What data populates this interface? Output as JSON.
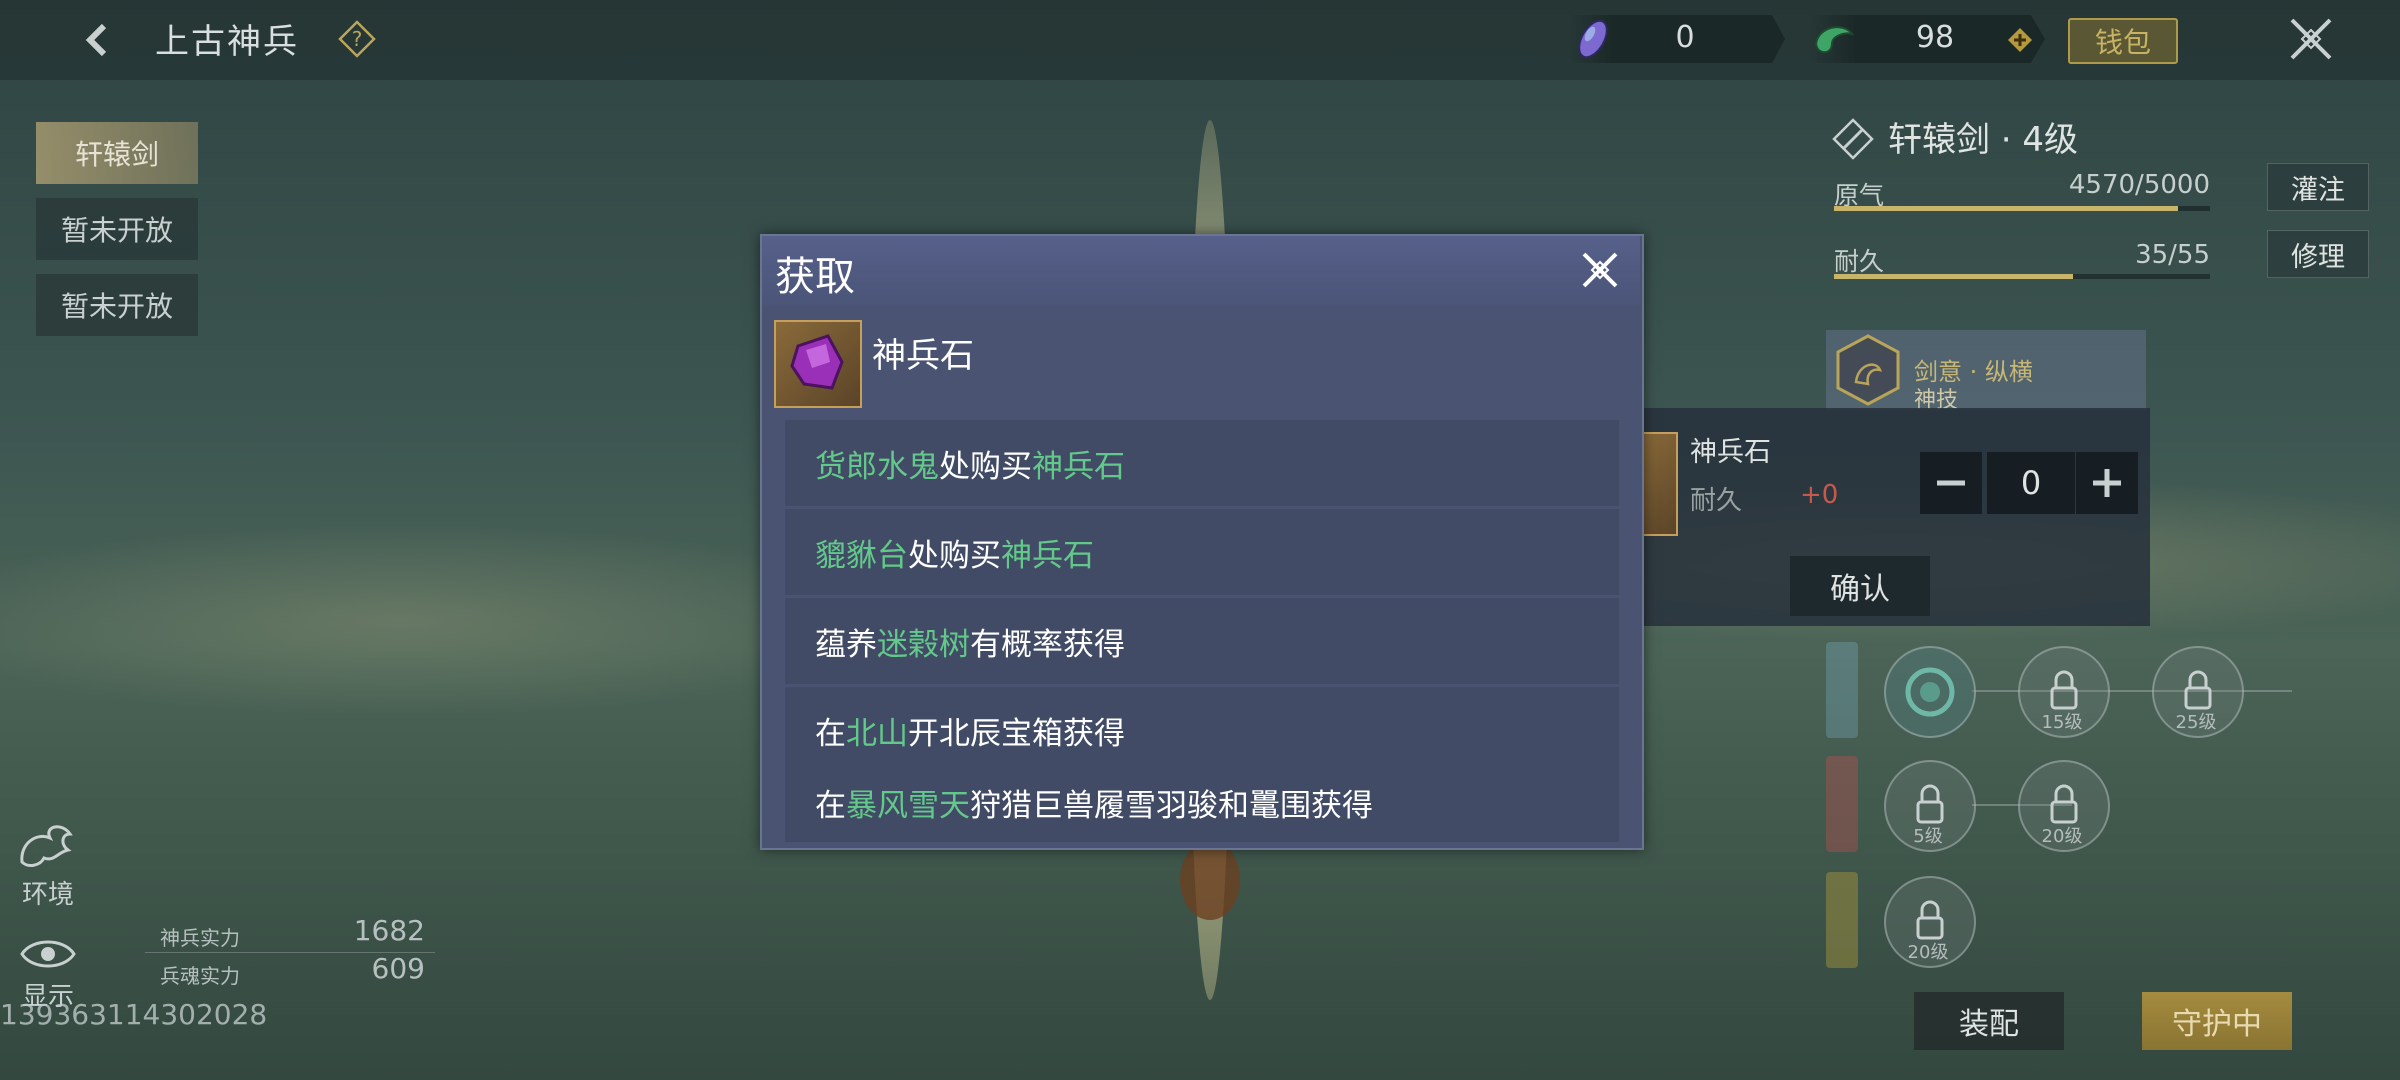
{
  "header": {
    "title": "上古神兵",
    "resource1_value": "0",
    "resource2_value": "98",
    "wallet_label": "钱包"
  },
  "tabs": [
    "轩辕剑",
    "暂未开放",
    "暂未开放"
  ],
  "weapon": {
    "name": "轩辕剑 · 4级",
    "stats": [
      {
        "label": "原气",
        "value": "4570/5000",
        "fill": 0.914,
        "button": "灌注"
      },
      {
        "label": "耐久",
        "value": "35/55",
        "fill": 0.636,
        "button": "修理"
      }
    ],
    "skill": {
      "name": "剑意 · 纵横",
      "sub": "神技"
    }
  },
  "buy_panel": {
    "item_name": "神兵石",
    "durability_label": "耐久",
    "durability_bonus": "+0",
    "quantity": "0",
    "confirm": "确认"
  },
  "slots": {
    "row1": [
      "15级",
      "25级"
    ],
    "row2": [
      "5级",
      "20级"
    ],
    "row3": [
      "20级"
    ]
  },
  "actions": {
    "equip": "装配",
    "guard": "守护中"
  },
  "bottom_left": {
    "env": "环境",
    "show": "显示",
    "power": [
      {
        "label": "神兵实力",
        "value": "1682"
      },
      {
        "label": "兵魂实力",
        "value": "609"
      }
    ],
    "uid": "139363114302028"
  },
  "modal": {
    "title": "获取",
    "item_name": "神兵石",
    "sources": [
      [
        {
          "t": "货郎水鬼",
          "g": true
        },
        {
          "t": "处购买",
          "g": false
        },
        {
          "t": "神兵石",
          "g": true
        }
      ],
      [
        {
          "t": "貔貅台",
          "g": true
        },
        {
          "t": "处购买",
          "g": false
        },
        {
          "t": "神兵石",
          "g": true
        }
      ],
      [
        {
          "t": "蕴养",
          "g": false
        },
        {
          "t": "迷榖树",
          "g": true
        },
        {
          "t": "有概率获得",
          "g": false
        }
      ],
      [
        {
          "t": "在",
          "g": false
        },
        {
          "t": "北山",
          "g": true
        },
        {
          "t": "开北辰宝箱获得",
          "g": false
        }
      ],
      [
        {
          "t": "在",
          "g": false
        },
        {
          "t": "暴风雪天",
          "g": true
        },
        {
          "t": "狩猎巨兽履雪羽骏和鼍围获得",
          "g": false
        }
      ]
    ]
  },
  "colors": {
    "highlight": "#63c98a",
    "gold": "#c9b46c",
    "modal_bg": "#4a5472"
  }
}
